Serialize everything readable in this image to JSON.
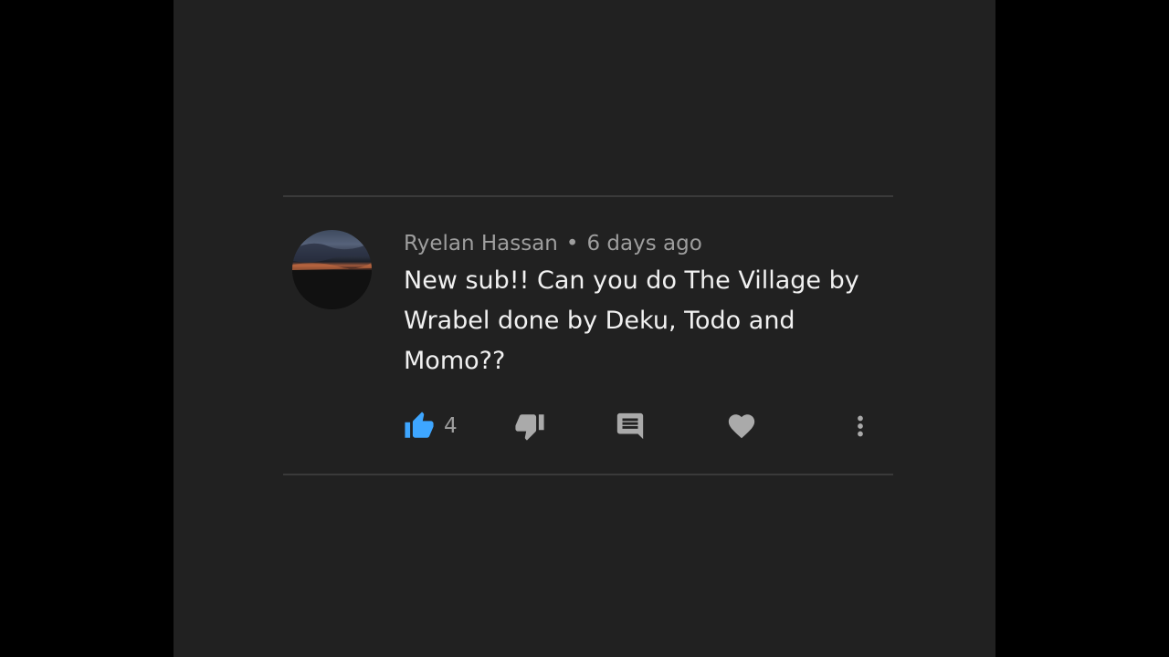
{
  "comment": {
    "author": "Ryelan Hassan",
    "separator": "•",
    "time": "6 days ago",
    "text": "New sub!! Can you do The Village by Wrabel done by Deku, Todo and Momo??",
    "avatar": "sunset-landscape-avatar"
  },
  "actions": {
    "like_count": "4",
    "like_icon": "thumbs-up-icon",
    "dislike_icon": "thumbs-down-icon",
    "reply_icon": "comment-icon",
    "heart_icon": "heart-icon",
    "more_icon": "more-vertical-icon"
  },
  "colors": {
    "background": "#212121",
    "letterbox": "#000000",
    "text_primary": "#f1f1f1",
    "text_secondary": "#9e9e9e",
    "like_active": "#3ea6ff",
    "icon_gray": "#aaaaaa"
  }
}
